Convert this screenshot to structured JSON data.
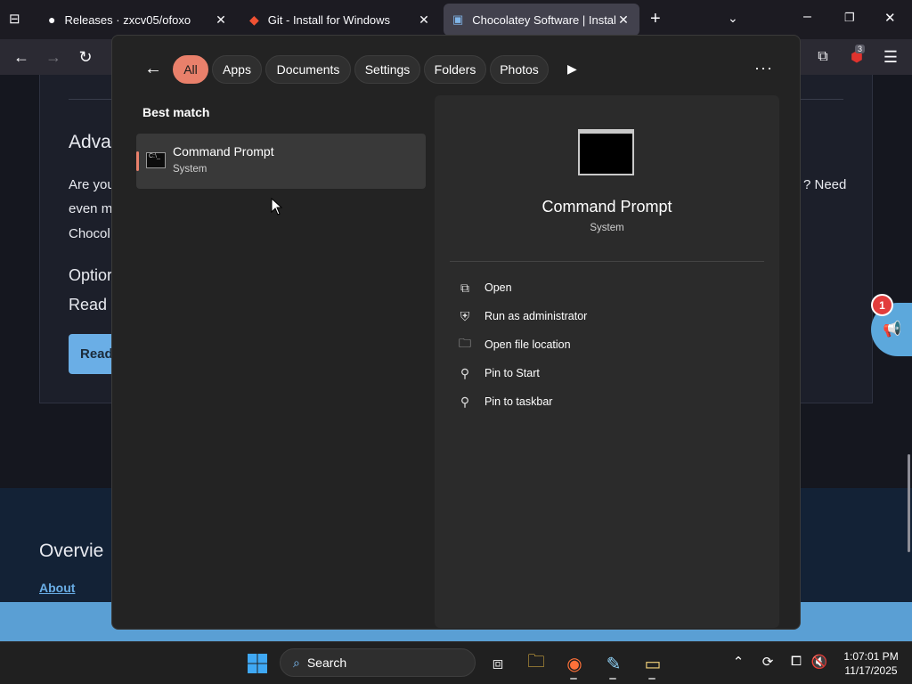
{
  "browser": {
    "tabs": [
      {
        "title": "Releases · zxcv05/ofoxo",
        "icon": "github-icon"
      },
      {
        "title": "Git - Install for Windows",
        "icon": "git-icon"
      },
      {
        "title": "Chocolatey Software | Installing",
        "icon": "chocolatey-icon"
      }
    ],
    "active_tab": 2,
    "extension_badge": "3"
  },
  "page": {
    "heading_partial": "Adva",
    "para_line1_partial": "Are you",
    "para_line1_right": "? Need",
    "para_line2_partial": "even m",
    "para_line3_partial": "Chocol",
    "option_partial": "Optior",
    "read_partial": "Read t",
    "read_button_partial": "Read",
    "footer_heading_partial": "Overvie",
    "footer_link": "About",
    "notification_count": "1"
  },
  "start_menu": {
    "filters": [
      "All",
      "Apps",
      "Documents",
      "Settings",
      "Folders",
      "Photos"
    ],
    "selected_filter": "All",
    "best_match_label": "Best match",
    "result": {
      "name": "Command Prompt",
      "type": "System"
    },
    "detail": {
      "name": "Command Prompt",
      "type": "System"
    },
    "actions": [
      {
        "label": "Open",
        "icon": "open-external-icon"
      },
      {
        "label": "Run as administrator",
        "icon": "admin-shield-icon"
      },
      {
        "label": "Open file location",
        "icon": "folder-icon"
      },
      {
        "label": "Pin to Start",
        "icon": "pin-icon"
      },
      {
        "label": "Pin to taskbar",
        "icon": "pin-icon"
      }
    ]
  },
  "taskbar": {
    "search_label": "Search",
    "time": "1:07:01 PM",
    "date": "11/17/2025"
  },
  "colors": {
    "accent": "#e9806b",
    "page_link": "#6aaee6"
  }
}
